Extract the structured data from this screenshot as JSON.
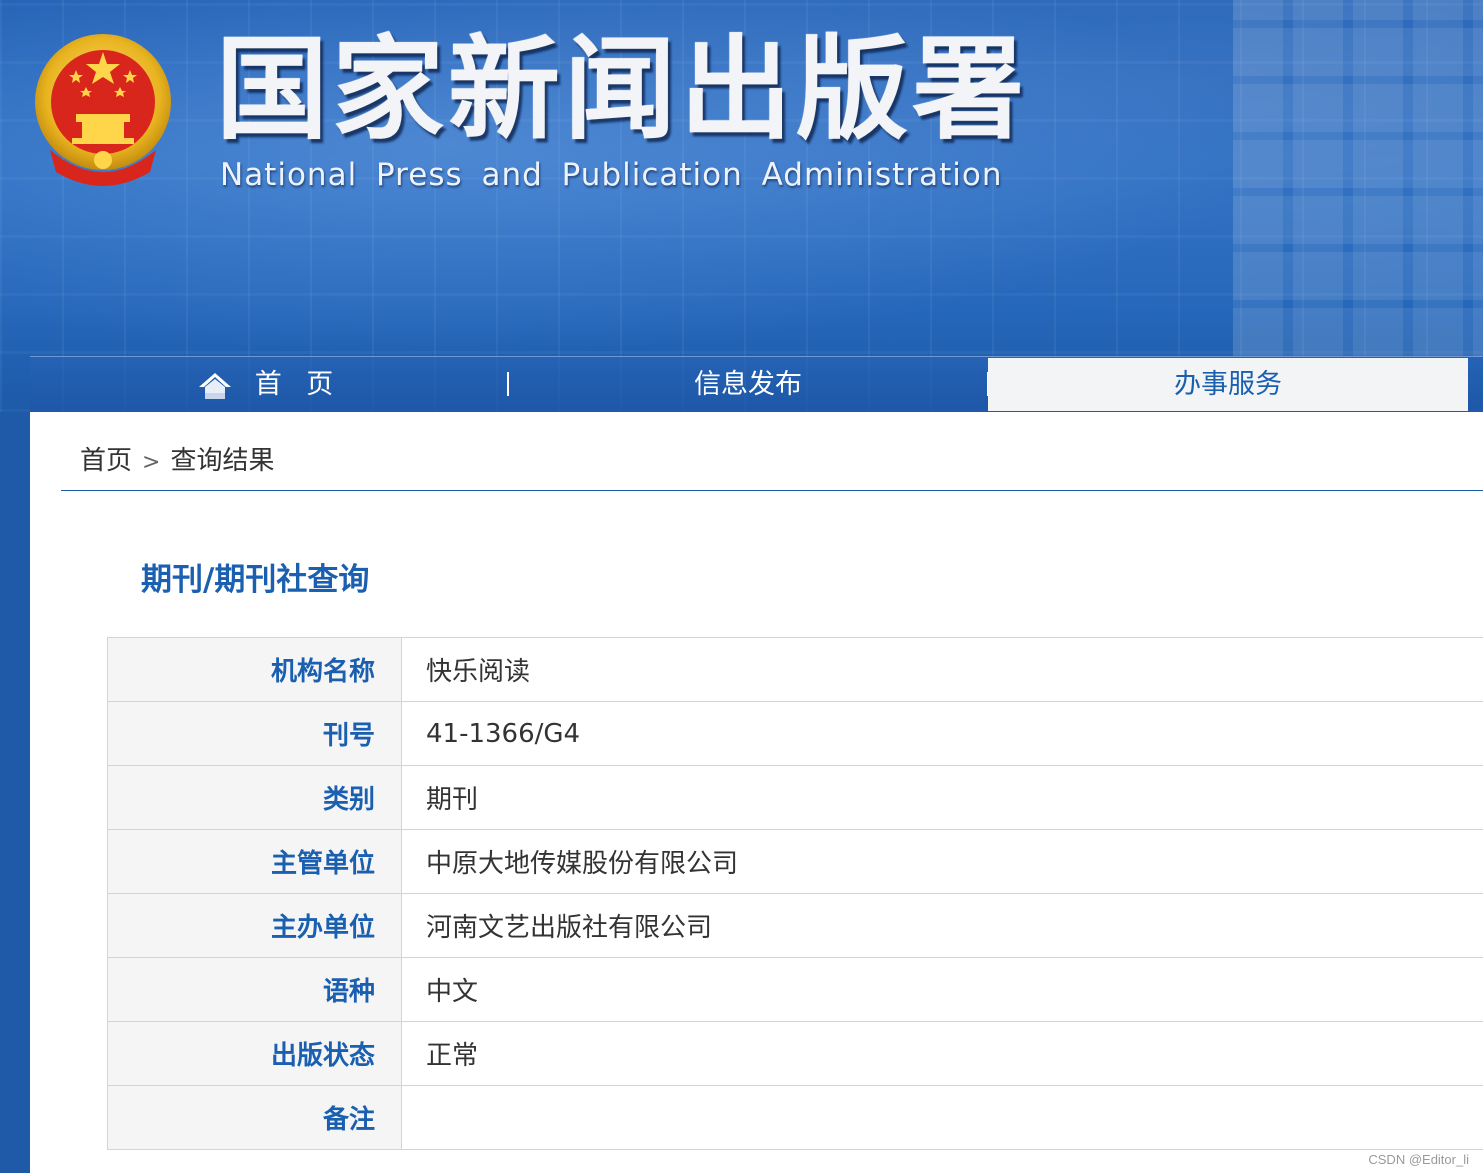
{
  "header": {
    "title": "国家新闻出版署",
    "subtitle": "National   Press and Publication Administration"
  },
  "nav": {
    "items": [
      {
        "label": "首 页",
        "icon": "home-icon"
      },
      {
        "label": "信息发布"
      },
      {
        "label": "办事服务",
        "active": true
      }
    ]
  },
  "breadcrumb": {
    "home": "首页",
    "separator": ">",
    "current": "查询结果"
  },
  "main": {
    "heading": "期刊/期刊社查询",
    "rows": [
      {
        "key": "机构名称",
        "value": "快乐阅读"
      },
      {
        "key": "刊号",
        "value": "41-1366/G4"
      },
      {
        "key": "类别",
        "value": "期刊"
      },
      {
        "key": "主管单位",
        "value": "中原大地传媒股份有限公司"
      },
      {
        "key": "主办单位",
        "value": "河南文艺出版社有限公司"
      },
      {
        "key": "语种",
        "value": "中文"
      },
      {
        "key": "出版状态",
        "value": "正常"
      },
      {
        "key": "备注",
        "value": ""
      }
    ]
  },
  "watermark": "CSDN @Editor_li",
  "colors": {
    "accent": "#1a5fb0",
    "banner": "#2563b6",
    "label_bg": "#f5f5f5"
  }
}
